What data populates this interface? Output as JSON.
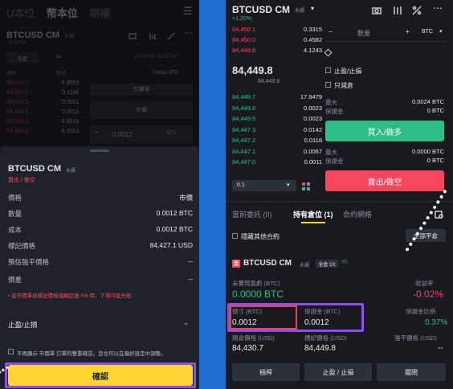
{
  "left": {
    "nav": {
      "tab1": "U本位",
      "tab2": "幣本位",
      "tab3": "期權"
    },
    "header": {
      "symbol": "BTCUSD CM",
      "badge": "永續",
      "change": "+1.17%"
    },
    "bg": {
      "cross": "全倉",
      "leverage": "1x",
      "col_price": "價格",
      "col_qty": "數量",
      "funding": "0.0027% / 01:37:44",
      "available": "0.0012 BTC",
      "order_type": "市價單",
      "market_price": "市價",
      "qty_value": "0.0012",
      "qty_unit": "BTC",
      "asks": [
        {
          "p": "84,431.7",
          "q": "0.3553"
        },
        {
          "p": "84,432.0",
          "q": "0.1184"
        },
        {
          "p": "84,432.6",
          "q": "0.0011"
        },
        {
          "p": "84,433.5",
          "q": "0.0011"
        },
        {
          "p": "84,434.6",
          "q": "0.3316"
        },
        {
          "p": "84,435.0",
          "q": "0.3553"
        }
      ]
    },
    "sheet": {
      "title": "BTCUSD CM",
      "badge": "永續",
      "side": "賣出 / 做空",
      "rows": [
        {
          "k": "價格",
          "v": "市價"
        },
        {
          "k": "數量",
          "v": "0.0012 BTC"
        },
        {
          "k": "成本",
          "v": "0.0012 BTC"
        },
        {
          "k": "標記價格",
          "v": "84,427.1 USD"
        },
        {
          "k": "預估強平價格",
          "v": "--"
        },
        {
          "k": "價差",
          "v": "--"
        }
      ],
      "warning": "當市價單與標記價格偏離超過 5% 時，下單可能失敗",
      "tpsl": "止盈/止損",
      "checkbox_text": "不再顯示 市價單 訂單的雙重確認。您也可以在偏好設定中調整。",
      "confirm": "確認"
    }
  },
  "right": {
    "header": {
      "symbol": "BTCUSD CM",
      "badge": "永續",
      "change": "+1.20%"
    },
    "asks": [
      {
        "p": "84,450.1",
        "q": "0.3315"
      },
      {
        "p": "84,450.0",
        "q": "0.4582"
      },
      {
        "p": "84,449.8",
        "q": "4.1243"
      }
    ],
    "last_price": "84,449.8",
    "mark_price": "84,449.8",
    "bids": [
      {
        "p": "84,449.7",
        "q": "17.9479"
      },
      {
        "p": "84,449.6",
        "q": "0.0023"
      },
      {
        "p": "84,449.5",
        "q": "0.0023"
      },
      {
        "p": "84,447.3",
        "q": "0.0142"
      },
      {
        "p": "84,447.2",
        "q": "0.0118"
      },
      {
        "p": "84,447.1",
        "q": "0.0067"
      },
      {
        "p": "84,447.0",
        "q": "0.0011"
      }
    ],
    "depth_step": "0.1",
    "form": {
      "qty_placeholder": "數量",
      "unit": "BTC",
      "tpsl": "止盈/止損",
      "reduce_only": "只減倉",
      "max_label": "最大",
      "max_buy": "0.0024 BTC",
      "margin_label": "保證金",
      "margin_buy": "0 BTC",
      "buy": "買入/做多",
      "max_sell": "0.0000 BTC",
      "margin_sell": "0 BTC",
      "sell": "賣出/做空"
    },
    "tabs": {
      "open_orders": "當前委託 (0)",
      "positions": "持有倉位 (1)",
      "grid": "合約網格"
    },
    "hide_other": "隱藏其他合約",
    "close_all": "全部平倉",
    "position": {
      "side_tag": "賣",
      "symbol": "BTCUSD CM",
      "badge": "永續",
      "mode": "全倉 1X",
      "bars": "!!!!",
      "pnl_label": "未實現盈虧 (BTC)",
      "pnl_value": "0.0000 BTC",
      "roe_label": "收益率",
      "roe_value": "-0.02%",
      "size_label": "頭寸 (BTC)",
      "size_value": "0.0012",
      "margin_label": "保證金 (BTC)",
      "margin_value": "0.0012",
      "margin_ratio_label": "保證金比例",
      "margin_ratio_value": "0.37%",
      "entry_label": "開倉價格 (USD)",
      "entry_value": "84,430.7",
      "mark_label": "標記價格 (USD)",
      "mark_value": "84,449.8",
      "liq_label": "強平價格 (USD)",
      "liq_value": "--",
      "btn_leverage": "槓桿",
      "btn_tpsl": "止盈 / 止損",
      "btn_close": "關閉"
    }
  },
  "colors": {
    "accent_yellow": "#fcd535",
    "green": "#2ebd85",
    "red": "#f6465d",
    "highlight_purple": "#8e4ef0",
    "highlight_red": "#e5484d",
    "background_blue": "#1e6fd0"
  }
}
